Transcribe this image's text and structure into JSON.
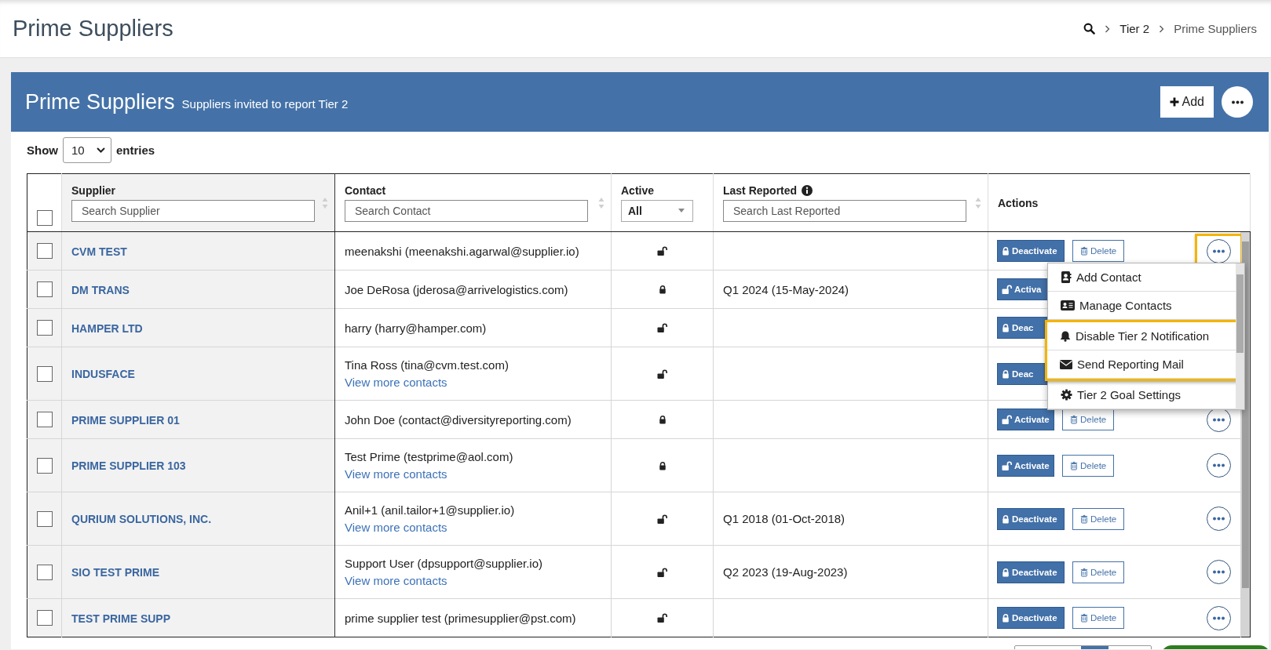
{
  "page_header": {
    "title": "Prime Suppliers",
    "breadcrumb": [
      "Tier 2",
      "Prime Suppliers"
    ]
  },
  "panel": {
    "title": "Prime Suppliers",
    "subtitle": "Suppliers invited to report Tier 2",
    "add_label": "Add"
  },
  "length_menu": {
    "label": "Show",
    "value": "10",
    "suffix": "entries"
  },
  "table": {
    "select_all_checked": false,
    "columns": [
      {
        "label": "Supplier",
        "sortable": true,
        "info": false,
        "filter": {
          "kind": "search",
          "placeholder": "Search Supplier"
        }
      },
      {
        "label": "Contact",
        "sortable": true,
        "info": false,
        "filter": {
          "kind": "search",
          "placeholder": "Search Contact"
        }
      },
      {
        "label": "Active",
        "sortable": false,
        "info": false,
        "filter": {
          "kind": "select",
          "value": "All"
        }
      },
      {
        "label": "Last Reported",
        "sortable": true,
        "info": true,
        "filter": {
          "kind": "search",
          "placeholder": "Search Last Reported"
        }
      },
      {
        "label": "Actions",
        "sortable": false,
        "info": false
      }
    ],
    "rows": [
      {
        "checked": false,
        "supplier": "CVM TEST",
        "contact": "meenakshi (meenakshi.agarwal@supplier.io)",
        "locked": false,
        "actions": [
          {
            "kind": "deactivate",
            "label": "Deactivate"
          },
          {
            "kind": "delete",
            "label": "Delete"
          },
          {
            "kind": "more",
            "highlighted": true
          }
        ]
      },
      {
        "checked": false,
        "supplier": "DM TRANS",
        "contact": "Joe DeRosa (jderosa@arrivelogistics.com)",
        "locked": true,
        "last_reported": "Q1 2024 (15-May-2024)",
        "actions": [
          {
            "kind": "activate",
            "label": "Activa"
          }
        ]
      },
      {
        "checked": false,
        "supplier": "HAMPER LTD",
        "contact": "harry (harry@hamper.com)",
        "locked": false,
        "actions": [
          {
            "kind": "deactivate",
            "label": "Deac"
          }
        ]
      },
      {
        "checked": false,
        "supplier": "INDUSFACE",
        "contact": "Tina Ross (tina@cvm.test.com)",
        "more_contacts": "View more contacts",
        "locked": false,
        "actions": [
          {
            "kind": "deactivate",
            "label": "Deac"
          }
        ]
      },
      {
        "checked": false,
        "supplier": "PRIME SUPPLIER 01",
        "contact": "John Doe (contact@diversityreporting.com)",
        "locked": true,
        "actions": [
          {
            "kind": "activate",
            "label": "Activate"
          },
          {
            "kind": "delete",
            "label": "Delete"
          },
          {
            "kind": "more",
            "highlighted": false
          }
        ]
      },
      {
        "checked": false,
        "supplier": "PRIME SUPPLIER 103",
        "contact": "Test Prime (testprime@aol.com)",
        "more_contacts": "View more contacts",
        "locked": true,
        "actions": [
          {
            "kind": "activate",
            "label": "Activate"
          },
          {
            "kind": "delete",
            "label": "Delete"
          },
          {
            "kind": "more",
            "highlighted": false
          }
        ]
      },
      {
        "checked": false,
        "supplier": "QURIUM SOLUTIONS, INC.",
        "contact": "Anil+1 (anil.tailor+1@supplier.io)",
        "more_contacts": "View more contacts",
        "locked": false,
        "last_reported": "Q1 2018 (01-Oct-2018)",
        "actions": [
          {
            "kind": "deactivate",
            "label": "Deactivate"
          },
          {
            "kind": "delete",
            "label": "Delete"
          },
          {
            "kind": "more",
            "highlighted": false
          }
        ]
      },
      {
        "checked": false,
        "supplier": "SIO TEST PRIME",
        "contact": "Support User (dpsupport@supplier.io)",
        "more_contacts": "View more contacts",
        "locked": false,
        "last_reported": "Q2 2023 (19-Aug-2023)",
        "actions": [
          {
            "kind": "deactivate",
            "label": "Deactivate"
          },
          {
            "kind": "delete",
            "label": "Delete"
          },
          {
            "kind": "more",
            "highlighted": false
          }
        ]
      },
      {
        "checked": false,
        "supplier": "TEST PRIME SUPP",
        "contact": "prime supplier test (primesupplier@pst.com)",
        "locked": false,
        "actions": [
          {
            "kind": "deactivate",
            "label": "Deactivate"
          },
          {
            "kind": "delete",
            "label": "Delete"
          },
          {
            "kind": "more",
            "highlighted": false
          }
        ]
      }
    ]
  },
  "menu": {
    "items": [
      {
        "kind": "add",
        "label": "Add Contact",
        "highlighted": false
      },
      {
        "kind": "manage",
        "label": "Manage Contacts",
        "highlighted": false
      },
      {
        "kind": "notify",
        "label": "Disable Tier 2 Notification",
        "highlighted": true
      },
      {
        "kind": "mail",
        "label": "Send Reporting Mail",
        "highlighted": true
      },
      {
        "kind": "settings",
        "label": "Tier 2 Goal Settings",
        "highlighted": false
      }
    ]
  }
}
